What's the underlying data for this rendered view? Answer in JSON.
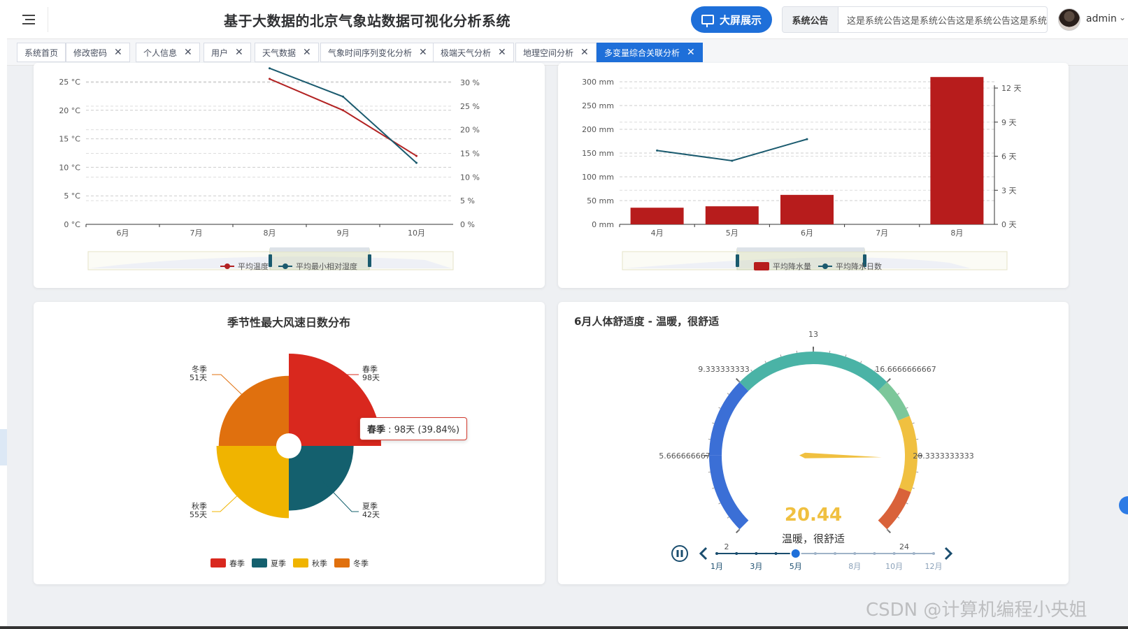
{
  "header": {
    "title": "基于大数据的北京气象站数据可视化分析系统",
    "big_screen_label": "大屏展示",
    "notice_label": "系统公告",
    "notice_text": "这是系统公告这是系统公告这是系统公告这是系统",
    "username": "admin",
    "colors": {
      "accent": "#1e6fd9"
    }
  },
  "tabs": [
    {
      "label": "系统首页",
      "closable": false,
      "active": false
    },
    {
      "label": "修改密码",
      "closable": true,
      "active": false
    },
    {
      "label": "个人信息",
      "closable": true,
      "active": false
    },
    {
      "label": "用户",
      "closable": true,
      "active": false
    },
    {
      "label": "天气数据",
      "closable": true,
      "active": false
    },
    {
      "label": "气象时间序列变化分析",
      "closable": true,
      "active": false
    },
    {
      "label": "极端天气分析",
      "closable": true,
      "active": false
    },
    {
      "label": "地理空间分析",
      "closable": true,
      "active": false
    },
    {
      "label": "多变量综合关联分析",
      "closable": true,
      "active": true
    }
  ],
  "chart_data": [
    {
      "type": "line",
      "categories": [
        "6月",
        "7月",
        "8月",
        "9月",
        "10月"
      ],
      "y_left": {
        "ticks": [
          "0 °C",
          "5 °C",
          "10 °C",
          "15 °C",
          "20 °C",
          "25 °C"
        ],
        "range": [
          0,
          25
        ]
      },
      "y_right": {
        "ticks": [
          "0 %",
          "5 %",
          "10 %",
          "15 %",
          "20 %",
          "25 %",
          "30 %"
        ],
        "range": [
          0,
          30
        ]
      },
      "series": [
        {
          "name": "平均温度",
          "axis": "left",
          "color": "#b22222",
          "values": [
            null,
            null,
            25.5,
            20,
            12
          ]
        },
        {
          "name": "平均最小相对湿度",
          "axis": "right",
          "color": "#1a5a6e",
          "values": [
            null,
            null,
            33,
            27,
            13
          ]
        }
      ],
      "legend_position": "bottom"
    },
    {
      "type": "bar",
      "categories": [
        "4月",
        "5月",
        "6月",
        "7月",
        "8月"
      ],
      "y_left": {
        "ticks": [
          "0 mm",
          "50 mm",
          "100 mm",
          "150 mm",
          "200 mm",
          "250 mm",
          "300 mm"
        ],
        "range": [
          0,
          300
        ]
      },
      "y_right": {
        "ticks": [
          "0 天",
          "3 天",
          "6 天",
          "9 天",
          "12 天"
        ],
        "range": [
          0,
          12
        ]
      },
      "series": [
        {
          "name": "平均降水量",
          "axis": "left",
          "type": "bar",
          "color": "#b71c1c",
          "values": [
            35,
            38,
            62,
            0,
            310
          ]
        },
        {
          "name": "平均降水日数",
          "axis": "right",
          "type": "line",
          "color": "#1a5a6e",
          "values": [
            6.5,
            5.6,
            7.5,
            null,
            null
          ]
        }
      ],
      "legend_position": "bottom"
    },
    {
      "type": "pie",
      "title": "季节性最大风速日数分布",
      "slices": [
        {
          "name": "春季",
          "value": 98,
          "unit": "天",
          "color": "#d9281e"
        },
        {
          "name": "夏季",
          "value": 42,
          "unit": "天",
          "color": "#14606e"
        },
        {
          "name": "秋季",
          "value": 55,
          "unit": "天",
          "color": "#f0b400"
        },
        {
          "name": "冬季",
          "value": 51,
          "unit": "天",
          "color": "#e0700e"
        }
      ],
      "tooltip": {
        "label": "春季",
        "text": " : 98天 (39.84%)"
      },
      "legend_position": "bottom"
    },
    {
      "type": "gauge",
      "title": "6月人体舒适度 - 温暖，很舒适",
      "min": 2,
      "max": 24,
      "value": 20.44,
      "value_text": "20.44",
      "status_text": "温暖，很舒适",
      "tick_labels": [
        "2",
        "5.666666667",
        "9.333333333",
        "13",
        "16.6666666667",
        "20.3333333333",
        "24"
      ],
      "timeline": {
        "labels": [
          "1月",
          "3月",
          "5月",
          "8月",
          "10月",
          "12月"
        ],
        "current_index": 5,
        "months": 12
      }
    }
  ],
  "watermark": "CSDN @计算机编程小央姐"
}
